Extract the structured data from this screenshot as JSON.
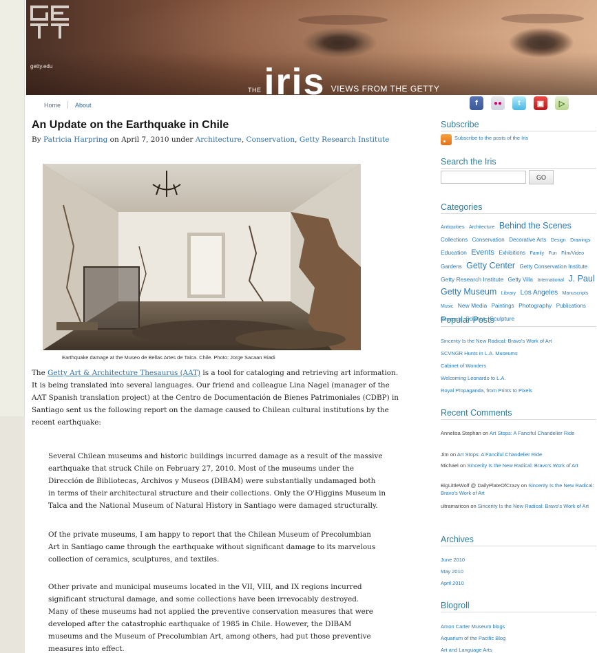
{
  "header": {
    "logo_text": "GETTY",
    "site_url": "getty.edu",
    "blog_prefix": "THE",
    "blog_name": "iris",
    "blog_tagline": "VIEWS FROM THE GETTY"
  },
  "nav": {
    "home": "Home",
    "about": "About"
  },
  "social_icons": [
    "facebook-icon",
    "flickr-icon",
    "twitter-icon",
    "youtube-icon",
    "video-icon"
  ],
  "post": {
    "title": "An Update on the Earthquake in Chile",
    "by": "By",
    "author": "Patricia Harpring",
    "date_text": "on April 7, 2010 under",
    "categories": [
      "Architecture",
      "Conservation",
      "Getty Research Institute"
    ],
    "image_caption": "Earthquake damage at the Museo de Bellas Artes de Talca. Chile. Photo: Jorge Sacaan Riadi",
    "intro_before_link": "The",
    "intro_link": "Getty Art & Architecture Thesaurus (AAT)",
    "intro_lines": [
      "is a tool for cataloging and retrieving art information.",
      "It is being translated into several languages. Our friend and colleague Lina Nagel (manager of the",
      "AAT Spanish translation project) at the Centro de Documentación de Bienes Patrimoniales (CDBP) in",
      "Santiago sent us the following report on the damage caused to Chilean cultural institutions by the",
      "recent earthquake:"
    ],
    "quote1": [
      "Several Chilean museums and historic buildings incurred damage as a result of the massive",
      "earthquake that struck Chile on February 27, 2010. Most of the museums under the",
      "Dirección de Bibliotecas, Archivos y Museos (DIBAM) were substantially undamaged both",
      "in terms of their architectural structure and their collections. Only the O'Higgins Museum in",
      "Talca and the National Museum of Natural History in Santiago were damaged structurally."
    ],
    "quote2": [
      "Of the private museums, I am happy to report that the Chilean Museum of Precolumbian",
      "Art in Santiago came through the earthquake without significant damage to its marvelous",
      "collection of ceramics, sculptures, and textiles."
    ],
    "quote3": [
      "Other private and municipal museums located in the VII, VIII, and IX regions incurred",
      "significant structural damage, and some collections have been irrevocably destroyed.",
      "Many of these museums had not applied the preventive conservation measures that were",
      "developed after the catastrophic earthquake of 1985 in Chile. However, the DIBAM",
      "museums and the Museum of Precolumbian Art, among others, had put those preventive",
      "measures into effect."
    ]
  },
  "sidebar": {
    "subscribe_heading": "Subscribe",
    "subscribe_link": "Subscribe to the posts of the Iris",
    "search_heading": "Search the Iris",
    "search_placeholder": "",
    "search_button": "GO",
    "categories_heading": "Categories",
    "categories": [
      {
        "label": "Antiquities",
        "size": 7.5
      },
      {
        "label": "Architecture",
        "size": 7
      },
      {
        "label": "Behind the Scenes",
        "size": 12.5
      },
      {
        "label": "Collections",
        "size": 8
      },
      {
        "label": "Conservation",
        "size": 8
      },
      {
        "label": "Decorative Arts",
        "size": 8
      },
      {
        "label": "Design",
        "size": 7
      },
      {
        "label": "Drawings",
        "size": 7
      },
      {
        "label": "Education",
        "size": 8.5
      },
      {
        "label": "Events",
        "size": 11
      },
      {
        "label": "Exhibitions",
        "size": 8
      },
      {
        "label": "Family",
        "size": 7
      },
      {
        "label": "Fun",
        "size": 7
      },
      {
        "label": "Film/Video",
        "size": 7
      },
      {
        "label": "Gardens",
        "size": 8
      },
      {
        "label": "Getty Center",
        "size": 12.5
      },
      {
        "label": "Getty Conservation Institute",
        "size": 8
      },
      {
        "label": "Getty Research Institute",
        "size": 8.5
      },
      {
        "label": "Getty Villa",
        "size": 8
      },
      {
        "label": "International",
        "size": 7
      },
      {
        "label": "J. Paul Getty Museum",
        "size": 12.5
      },
      {
        "label": "Library",
        "size": 7
      },
      {
        "label": "Los Angeles",
        "size": 10
      },
      {
        "label": "Manuscripts",
        "size": 7
      },
      {
        "label": "Music",
        "size": 7
      },
      {
        "label": "New Media",
        "size": 8.5
      },
      {
        "label": "Paintings",
        "size": 8
      },
      {
        "label": "Photography",
        "size": 8.5
      },
      {
        "label": "Publications",
        "size": 8
      },
      {
        "label": "Research",
        "size": 7
      },
      {
        "label": "Science",
        "size": 8
      },
      {
        "label": "Sculpture",
        "size": 8.5
      }
    ],
    "popular_heading": "Popular Posts",
    "popular": [
      "Sincerity Is the New Radical: Bravo's Work of Art",
      "SCVNGR Hunts in L.A. Museums",
      "Cabinet of Wonders",
      "Welcoming Leonardo to L.A.",
      "Royal Propaganda, from Prints to Pixels"
    ],
    "comments_heading": "Recent Comments",
    "comments": [
      {
        "author": "Annelisa Stephan",
        "on": "on",
        "post": "Art Stops: A Fanciful Chandelier Ride"
      },
      {
        "author": "Jim",
        "on": "on",
        "post": "Art Stops: A Fanciful Chandelier Ride"
      },
      {
        "author": "Michael",
        "on": "on",
        "post": "Sincerity Is the New Radical: Bravo's Work of Art"
      },
      {
        "author": "BigLittleWolf @ DailyPlateOfCrazy",
        "on": "on",
        "post": "Sincerity Is the New Radical: Bravo's Work of Art"
      },
      {
        "author": "ultramaricon",
        "on": "on",
        "post": "Sincerity Is the New Radical: Bravo's Work of Art"
      }
    ],
    "archives_heading": "Archives",
    "archives": [
      "June 2010",
      "May 2010",
      "April 2010"
    ],
    "blogroll_heading": "Blogroll",
    "blogroll": [
      "Amon Carter Museum blogs",
      "Aquarium of the Pacific Blog",
      "Art and Language Arts"
    ]
  }
}
